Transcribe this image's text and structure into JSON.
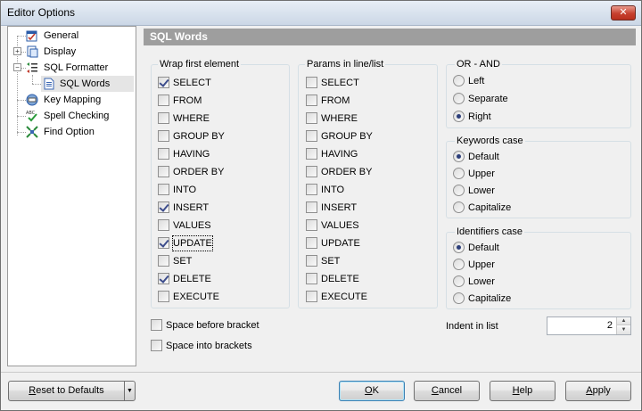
{
  "window": {
    "title": "Editor Options",
    "close_icon": "close-icon"
  },
  "tree": {
    "items": [
      {
        "label": "General",
        "icon": "general-icon"
      },
      {
        "label": "Display",
        "icon": "display-icon"
      },
      {
        "label": "SQL Formatter",
        "icon": "sql-formatter-icon"
      },
      {
        "label": "SQL Words",
        "icon": "document-icon",
        "selected": true
      },
      {
        "label": "Key Mapping",
        "icon": "key-mapping-icon"
      },
      {
        "label": "Spell Checking",
        "icon": "spell-check-icon"
      },
      {
        "label": "Find Option",
        "icon": "find-icon"
      }
    ]
  },
  "header": {
    "title": "SQL Words"
  },
  "wrap_first": {
    "title": "Wrap first element",
    "items": [
      {
        "label": "SELECT",
        "checked": true
      },
      {
        "label": "FROM",
        "checked": false
      },
      {
        "label": "WHERE",
        "checked": false
      },
      {
        "label": "GROUP BY",
        "checked": false
      },
      {
        "label": "HAVING",
        "checked": false
      },
      {
        "label": "ORDER BY",
        "checked": false
      },
      {
        "label": "INTO",
        "checked": false
      },
      {
        "label": "INSERT",
        "checked": true
      },
      {
        "label": "VALUES",
        "checked": false
      },
      {
        "label": "UPDATE",
        "checked": true
      },
      {
        "label": "SET",
        "checked": false
      },
      {
        "label": "DELETE",
        "checked": true
      },
      {
        "label": "EXECUTE",
        "checked": false
      }
    ]
  },
  "params_line": {
    "title": "Params in line/list",
    "items": [
      {
        "label": "SELECT",
        "checked": false
      },
      {
        "label": "FROM",
        "checked": false
      },
      {
        "label": "WHERE",
        "checked": false
      },
      {
        "label": "GROUP BY",
        "checked": false
      },
      {
        "label": "HAVING",
        "checked": false
      },
      {
        "label": "ORDER BY",
        "checked": false
      },
      {
        "label": "INTO",
        "checked": false
      },
      {
        "label": "INSERT",
        "checked": false
      },
      {
        "label": "VALUES",
        "checked": false
      },
      {
        "label": "UPDATE",
        "checked": false
      },
      {
        "label": "SET",
        "checked": false
      },
      {
        "label": "DELETE",
        "checked": false
      },
      {
        "label": "EXECUTE",
        "checked": false
      }
    ]
  },
  "or_and": {
    "title": "OR - AND",
    "options": [
      "Left",
      "Separate",
      "Right"
    ],
    "selected": "Right"
  },
  "keywords_case": {
    "title": "Keywords case",
    "options": [
      "Default",
      "Upper",
      "Lower",
      "Capitalize"
    ],
    "selected": "Default"
  },
  "identifiers_case": {
    "title": "Identifiers case",
    "options": [
      "Default",
      "Upper",
      "Lower",
      "Capitalize"
    ],
    "selected": "Default"
  },
  "space_before_bracket": {
    "label": "Space before bracket",
    "checked": false
  },
  "space_into_brackets": {
    "label": "Space into brackets",
    "checked": false
  },
  "indent": {
    "label": "Indent in list",
    "value": "2"
  },
  "buttons": {
    "reset": "Reset to Defaults",
    "ok": "OK",
    "cancel": "Cancel",
    "help": "Help",
    "apply": "Apply"
  }
}
